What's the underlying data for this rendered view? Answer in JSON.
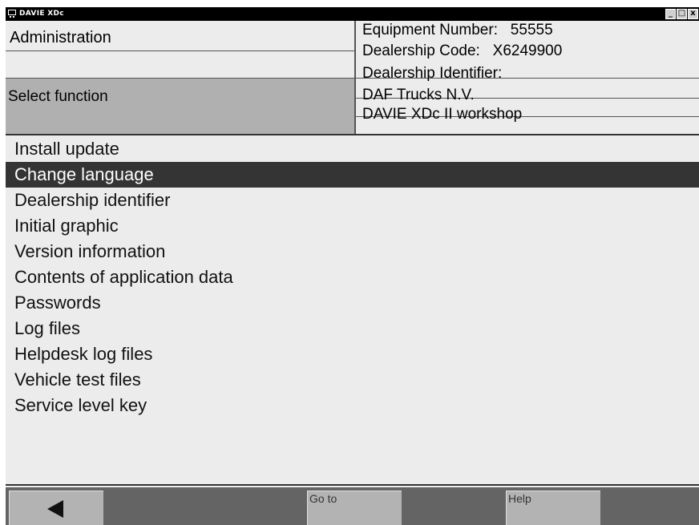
{
  "window": {
    "title": "DAVIE XDc",
    "controls": [
      "_",
      "□",
      "x"
    ]
  },
  "header": {
    "module": "Administration",
    "status": "",
    "instruction": "Select function",
    "info": {
      "equipment_number": "Equipment Number:   55555",
      "dealership_code": "Dealership Code:   X6249900",
      "dealership_identifier_label": "Dealership Identifier:",
      "company": "DAF Trucks N.V.",
      "workshop": "DAVIE XDc II workshop"
    }
  },
  "menu": {
    "selected_index": 1,
    "items": [
      "Install update",
      "Change language",
      "Dealership identifier",
      "Initial graphic",
      "Version information",
      "Contents of application data",
      "Passwords",
      "Log files",
      "Helpdesk log files",
      "Vehicle test files",
      "Service level key"
    ]
  },
  "toolbar": {
    "back_icon": "left-arrow-icon",
    "goto_label": "Go to",
    "help_label": "Help"
  },
  "colors": {
    "selected_row": "#343434",
    "toolbar_bg": "#646464",
    "button_bg": "#b3b3b3",
    "panel_bg": "#ececec"
  }
}
